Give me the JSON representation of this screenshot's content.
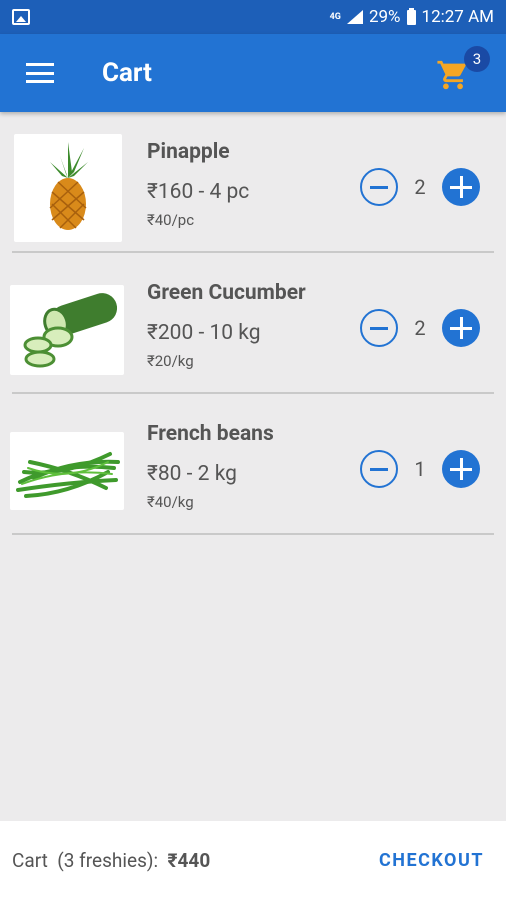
{
  "status_bar": {
    "network": "4G",
    "battery": "29%",
    "time": "12:27 AM"
  },
  "app_bar": {
    "title": "Cart",
    "cart_count": "3"
  },
  "items": [
    {
      "name": "Pinapple",
      "price": "₹160 - 4 pc",
      "unit_price": "₹40/pc",
      "qty": "2"
    },
    {
      "name": "Green Cucumber",
      "price": "₹200 - 10 kg",
      "unit_price": "₹20/kg",
      "qty": "2"
    },
    {
      "name": "French beans",
      "price": "₹80 - 2 kg",
      "unit_price": "₹40/kg",
      "qty": "1"
    }
  ],
  "footer": {
    "cart_label": "Cart",
    "freshies": "(3 freshies):",
    "total": "₹440",
    "checkout": "CHECKOUT"
  },
  "colors": {
    "status_bar": "#1d5fb8",
    "app_bar": "#2273d3",
    "accent": "#2273d3",
    "cart_icon": "#f5a623"
  }
}
